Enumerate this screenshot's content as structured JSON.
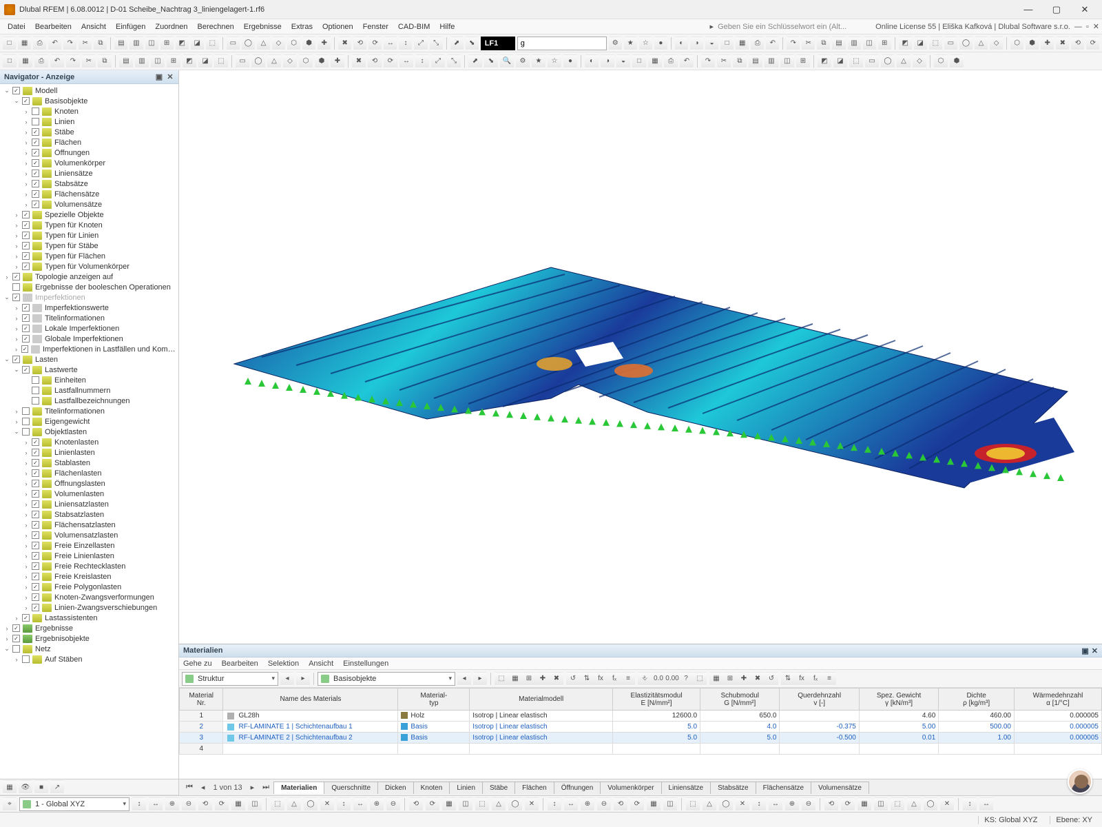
{
  "title": "Dlubal RFEM | 6.08.0012 | D-01 Scheibe_Nachtrag 3_liniengelagert-1.rf6",
  "license": "Online License 55 | Eliška Kafková | Dlubal Software s.r.o.",
  "search_placeholder": "Geben Sie ein Schlüsselwort ein (Alt...",
  "menus": [
    "Datei",
    "Bearbeiten",
    "Ansicht",
    "Einfügen",
    "Zuordnen",
    "Berechnen",
    "Ergebnisse",
    "Extras",
    "Optionen",
    "Fenster",
    "CAD-BIM",
    "Hilfe"
  ],
  "loadcase_label": "LF1",
  "loadcase_desc": "g",
  "navigator": {
    "title": "Navigator - Anzeige",
    "tree": [
      {
        "d": 0,
        "e": 1,
        "c": 1,
        "i": "ylw",
        "t": "Modell"
      },
      {
        "d": 1,
        "e": 1,
        "c": 1,
        "i": "ylw",
        "t": "Basisobjekte"
      },
      {
        "d": 2,
        "e": 0,
        "c": 0,
        "i": "ylw",
        "t": "Knoten"
      },
      {
        "d": 2,
        "e": 0,
        "c": 0,
        "i": "ylw",
        "t": "Linien"
      },
      {
        "d": 2,
        "e": 0,
        "c": 1,
        "i": "ylw",
        "t": "Stäbe"
      },
      {
        "d": 2,
        "e": 0,
        "c": 1,
        "i": "ylw",
        "t": "Flächen"
      },
      {
        "d": 2,
        "e": 0,
        "c": 1,
        "i": "ylw",
        "t": "Öffnungen"
      },
      {
        "d": 2,
        "e": 0,
        "c": 1,
        "i": "ylw",
        "t": "Volumenkörper"
      },
      {
        "d": 2,
        "e": 0,
        "c": 1,
        "i": "ylw",
        "t": "Liniensätze"
      },
      {
        "d": 2,
        "e": 0,
        "c": 1,
        "i": "ylw",
        "t": "Stabsätze"
      },
      {
        "d": 2,
        "e": 0,
        "c": 1,
        "i": "ylw",
        "t": "Flächensätze"
      },
      {
        "d": 2,
        "e": 0,
        "c": 1,
        "i": "ylw",
        "t": "Volumensätze"
      },
      {
        "d": 1,
        "e": 0,
        "c": 1,
        "i": "ylw",
        "t": "Spezielle Objekte"
      },
      {
        "d": 1,
        "e": 0,
        "c": 1,
        "i": "ylw",
        "t": "Typen für Knoten"
      },
      {
        "d": 1,
        "e": 0,
        "c": 1,
        "i": "ylw",
        "t": "Typen für Linien"
      },
      {
        "d": 1,
        "e": 0,
        "c": 1,
        "i": "ylw",
        "t": "Typen für Stäbe"
      },
      {
        "d": 1,
        "e": 0,
        "c": 1,
        "i": "ylw",
        "t": "Typen für Flächen"
      },
      {
        "d": 1,
        "e": 0,
        "c": 1,
        "i": "ylw",
        "t": "Typen für Volumenkörper"
      },
      {
        "d": 0,
        "e": 0,
        "c": 1,
        "i": "ylw",
        "t": "Topologie anzeigen auf"
      },
      {
        "d": 0,
        "e": -1,
        "c": 0,
        "i": "ylw",
        "t": "Ergebnisse der booleschen Operationen"
      },
      {
        "d": 0,
        "e": 1,
        "c": 1,
        "i": "gry",
        "t": "Imperfektionen",
        "dim": 1
      },
      {
        "d": 1,
        "e": 0,
        "c": 1,
        "i": "gry",
        "t": "Imperfektionswerte"
      },
      {
        "d": 1,
        "e": 0,
        "c": 1,
        "i": "gry",
        "t": "Titelinformationen"
      },
      {
        "d": 1,
        "e": 0,
        "c": 1,
        "i": "gry",
        "t": "Lokale Imperfektionen"
      },
      {
        "d": 1,
        "e": 0,
        "c": 1,
        "i": "gry",
        "t": "Globale Imperfektionen"
      },
      {
        "d": 1,
        "e": 0,
        "c": 1,
        "i": "gry",
        "t": "Imperfektionen in Lastfällen und Kombina..."
      },
      {
        "d": 0,
        "e": 1,
        "c": 1,
        "i": "ylw",
        "t": "Lasten"
      },
      {
        "d": 1,
        "e": 1,
        "c": 1,
        "i": "ylw",
        "t": "Lastwerte"
      },
      {
        "d": 2,
        "e": -1,
        "c": 0,
        "i": "ylw",
        "t": "Einheiten"
      },
      {
        "d": 2,
        "e": -1,
        "c": 0,
        "i": "ylw",
        "t": "Lastfallnummern"
      },
      {
        "d": 2,
        "e": -1,
        "c": 0,
        "i": "ylw",
        "t": "Lastfallbezeichnungen"
      },
      {
        "d": 1,
        "e": 0,
        "c": 0,
        "i": "ylw",
        "t": "Titelinformationen"
      },
      {
        "d": 1,
        "e": 0,
        "c": 0,
        "i": "ylw",
        "t": "Eigengewicht"
      },
      {
        "d": 1,
        "e": 1,
        "c": 0,
        "i": "ylw",
        "t": "Objektlasten"
      },
      {
        "d": 2,
        "e": 0,
        "c": 1,
        "i": "ylw",
        "t": "Knotenlasten"
      },
      {
        "d": 2,
        "e": 0,
        "c": 1,
        "i": "ylw",
        "t": "Linienlasten"
      },
      {
        "d": 2,
        "e": 0,
        "c": 1,
        "i": "ylw",
        "t": "Stablasten"
      },
      {
        "d": 2,
        "e": 0,
        "c": 1,
        "i": "ylw",
        "t": "Flächenlasten"
      },
      {
        "d": 2,
        "e": 0,
        "c": 1,
        "i": "ylw",
        "t": "Öffnungslasten"
      },
      {
        "d": 2,
        "e": 0,
        "c": 1,
        "i": "ylw",
        "t": "Volumenlasten"
      },
      {
        "d": 2,
        "e": 0,
        "c": 1,
        "i": "ylw",
        "t": "Liniensatzlasten"
      },
      {
        "d": 2,
        "e": 0,
        "c": 1,
        "i": "ylw",
        "t": "Stabsatzlasten"
      },
      {
        "d": 2,
        "e": 0,
        "c": 1,
        "i": "ylw",
        "t": "Flächensatzlasten"
      },
      {
        "d": 2,
        "e": 0,
        "c": 1,
        "i": "ylw",
        "t": "Volumensatzlasten"
      },
      {
        "d": 2,
        "e": 0,
        "c": 1,
        "i": "ylw",
        "t": "Freie Einzellasten"
      },
      {
        "d": 2,
        "e": 0,
        "c": 1,
        "i": "ylw",
        "t": "Freie Linienlasten"
      },
      {
        "d": 2,
        "e": 0,
        "c": 1,
        "i": "ylw",
        "t": "Freie Rechtecklasten"
      },
      {
        "d": 2,
        "e": 0,
        "c": 1,
        "i": "ylw",
        "t": "Freie Kreislasten"
      },
      {
        "d": 2,
        "e": 0,
        "c": 1,
        "i": "ylw",
        "t": "Freie Polygonlasten"
      },
      {
        "d": 2,
        "e": 0,
        "c": 1,
        "i": "ylw",
        "t": "Knoten-Zwangsverformungen"
      },
      {
        "d": 2,
        "e": 0,
        "c": 1,
        "i": "ylw",
        "t": "Linien-Zwangsverschiebungen"
      },
      {
        "d": 1,
        "e": 0,
        "c": 1,
        "i": "ylw",
        "t": "Lastassistenten"
      },
      {
        "d": 0,
        "e": 0,
        "c": 1,
        "i": "grn",
        "t": "Ergebnisse"
      },
      {
        "d": 0,
        "e": 0,
        "c": 1,
        "i": "grn",
        "t": "Ergebnisobjekte"
      },
      {
        "d": 0,
        "e": 1,
        "c": 0,
        "i": "ylw",
        "t": "Netz"
      },
      {
        "d": 1,
        "e": 0,
        "c": 0,
        "i": "ylw",
        "t": "Auf Stäben"
      }
    ]
  },
  "materials": {
    "title": "Materialien",
    "menu": [
      "Gehe zu",
      "Bearbeiten",
      "Selektion",
      "Ansicht",
      "Einstellungen"
    ],
    "combo1": "Struktur",
    "combo2": "Basisobjekte",
    "headers": {
      "nr": "Material\nNr.",
      "name": "Name des Materials",
      "typ": "Material-\ntyp",
      "modell": "Materialmodell",
      "e": "Elastizitätsmodul\nE [N/mm²]",
      "g": "Schubmodul\nG [N/mm²]",
      "v": "Querdehnzahl\nv [-]",
      "gamma": "Spez. Gewicht\nγ [kN/m³]",
      "rho": "Dichte\nρ [kg/m³]",
      "alpha": "Wärmedehnzahl\nα [1/°C]"
    },
    "rows": [
      {
        "nr": "1",
        "name": "GL28h",
        "color": "#b0b0b0",
        "typ": "Holz",
        "typcolor": "#8a7a40",
        "modell": "Isotrop | Linear elastisch",
        "e": "12600.0",
        "g": "650.0",
        "v": "",
        "gamma": "4.60",
        "rho": "460.00",
        "alpha": "0.000005"
      },
      {
        "nr": "2",
        "name": "RF-LAMINATE 1 | Schichtenaufbau 1",
        "color": "#70c8e8",
        "typ": "Basis",
        "typcolor": "#3aa0d8",
        "modell": "Isotrop | Linear elastisch",
        "e": "5.0",
        "g": "4.0",
        "v": "-0.375",
        "gamma": "5.00",
        "rho": "500.00",
        "alpha": "0.000005",
        "blue": 1
      },
      {
        "nr": "3",
        "name": "RF-LAMINATE 2 | Schichtenaufbau 2",
        "color": "#70c8e8",
        "typ": "Basis",
        "typcolor": "#3aa0d8",
        "modell": "Isotrop | Linear elastisch",
        "e": "5.0",
        "g": "5.0",
        "v": "-0.500",
        "gamma": "0.01",
        "rho": "1.00",
        "alpha": "0.000005",
        "blue": 1,
        "sel": 1
      },
      {
        "nr": "4",
        "name": "",
        "color": "",
        "typ": "",
        "modell": "",
        "e": "",
        "g": "",
        "v": "",
        "gamma": "",
        "rho": "",
        "alpha": ""
      }
    ],
    "pager": "1 von 13",
    "tabs": [
      "Materialien",
      "Querschnitte",
      "Dicken",
      "Knoten",
      "Linien",
      "Stäbe",
      "Flächen",
      "Öffnungen",
      "Volumenkörper",
      "Liniensätze",
      "Stabsätze",
      "Flächensätze",
      "Volumensätze"
    ]
  },
  "status": {
    "cs": "1 - Global XYZ",
    "ks": "KS: Global XYZ",
    "ebene": "Ebene: XY"
  }
}
